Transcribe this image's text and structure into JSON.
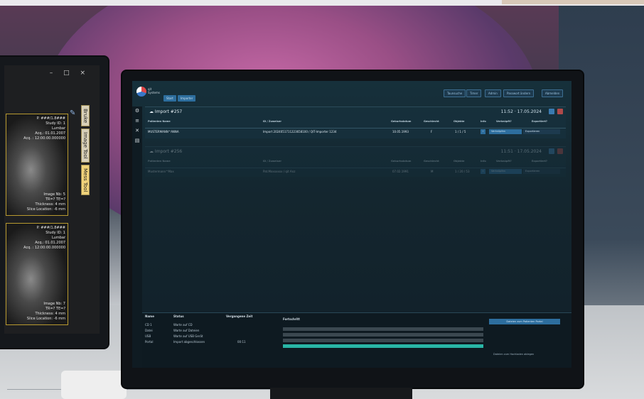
{
  "left_window": {
    "controls": [
      "–",
      "□",
      "×"
    ],
    "tabs": [
      {
        "label": "Bruke",
        "active": false
      },
      {
        "label": "Image Tool",
        "active": false
      },
      {
        "label": "Mess Tool",
        "active": true
      }
    ],
    "images": [
      {
        "top_overlay": [
          "P. ###/1.8### ",
          "Study ID: 1",
          "Lumbar",
          "Acq.: 01.01.2007",
          "Acq. : 12:00:00.000000"
        ],
        "bottom_overlay": [
          "Image Nb: 5",
          "TR=? TE=?",
          "Thickness: 4 mm",
          "Slice Location: -6 mm"
        ]
      },
      {
        "top_overlay": [
          "P. ###/1.8### ",
          "Study ID: 1",
          "Lumbar",
          "Acq.: 01.01.2007",
          "Acq. : 12:00:00.000000"
        ],
        "bottom_overlay": [
          "Image Nb: 7",
          "TR=? TE=?",
          "Thickness: 4 mm",
          "Slice Location: -6 mm"
        ]
      }
    ]
  },
  "app": {
    "logo_text": [
      "qit",
      "Systems"
    ],
    "top_buttons": [
      "Start",
      "Importer"
    ],
    "right_buttons": [
      "Taunsuche",
      "Timer",
      "Admin",
      "Passwort ändern",
      "Abmelden"
    ],
    "sidebar_icons": [
      "settings-icon",
      "list-icon",
      "tools-icon",
      "document-icon"
    ]
  },
  "imports": [
    {
      "title": "Import #257",
      "time": "11:52 · 17.05.2024",
      "headers": [
        "Patienten Name",
        "ID / Zuweiser",
        "Geburtsdatum",
        "Geschlecht",
        "Objekte",
        "Info",
        "Verknüpft?",
        "Exportiert?"
      ],
      "row": [
        "MUSTERMANN^ANNA",
        "Import 2024051711223658100 / QIT-Importer 1234",
        "10.05.1993",
        "F",
        "1 / 1 / 5",
        "",
        "Verknüpfen",
        "Exportieren"
      ]
    },
    {
      "title": "Import #256",
      "time": "11:51 · 17.05.2024",
      "headers": [
        "Patienten Name",
        "ID / Zuweiser",
        "Geburtsdatum",
        "Geschlecht",
        "Objekte",
        "Info",
        "Verknüpft?",
        "Exportiert?"
      ],
      "row": [
        "Mustermann^Max",
        "Pat.Mxxxxxxx / qit Anz",
        "07.02.1991",
        "M",
        "1 / 20 / 53",
        "",
        "Verknüpfen",
        "Exportieren"
      ]
    }
  ],
  "status_panel": {
    "headers": [
      "Name",
      "Status",
      "Vergangene Zeit",
      "Fortschritt"
    ],
    "rows": [
      {
        "name": "CD 1",
        "status": "Warte auf CD",
        "time": "",
        "progress": 0
      },
      {
        "name": "Datei",
        "status": "Warte auf Dateien",
        "time": "",
        "progress": 0
      },
      {
        "name": "USB",
        "status": "Warte auf USB Gerät",
        "time": "",
        "progress": 0
      },
      {
        "name": "Portal",
        "status": "Import abgeschlossen",
        "time": "00:11",
        "progress": 1
      }
    ],
    "upload_button": "Dateien zum Patienten Portal",
    "hint": "Dateien zum Hochladen ablegen",
    "progress_color": "#29b6a6"
  }
}
